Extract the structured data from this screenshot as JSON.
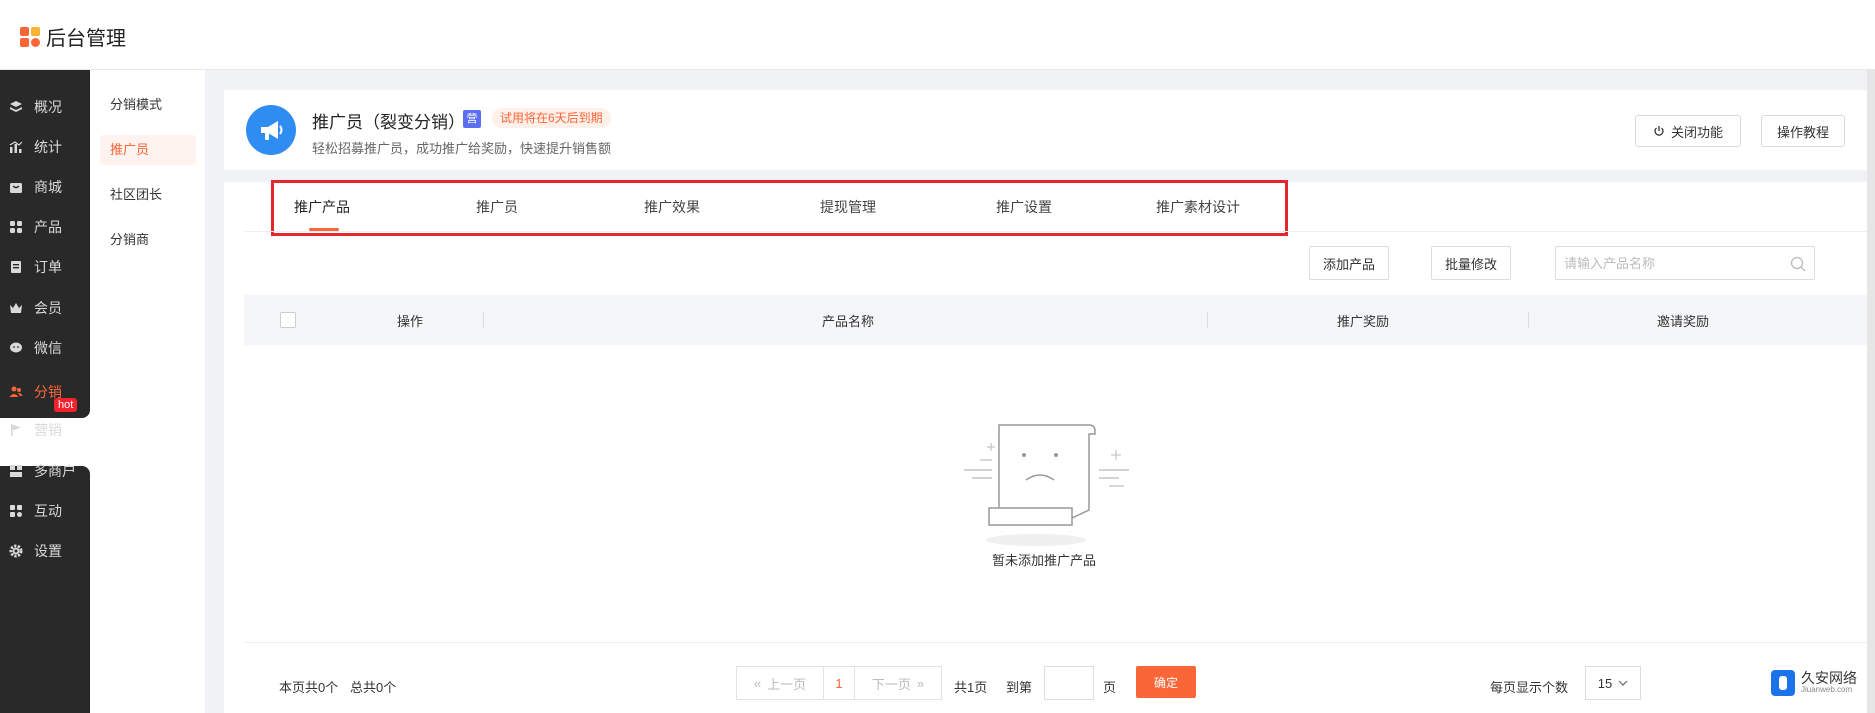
{
  "app": {
    "title": "后台管理"
  },
  "colors": {
    "accent": "#fb6638",
    "sidebar": "#292929",
    "highlight_box": "#e5262d",
    "logo": [
      "#fb6638",
      "#fdb336",
      "#fb6638",
      "#fb6638"
    ]
  },
  "sidebar": {
    "items": [
      {
        "label": "概况",
        "icon": "layers-icon"
      },
      {
        "label": "统计",
        "icon": "chart-icon"
      },
      {
        "label": "商城",
        "icon": "store-icon"
      },
      {
        "label": "产品",
        "icon": "grid-icon"
      },
      {
        "label": "订单",
        "icon": "order-icon"
      },
      {
        "label": "会员",
        "icon": "crown-icon"
      },
      {
        "label": "微信",
        "icon": "wechat-icon"
      },
      {
        "label": "分销",
        "icon": "users-icon",
        "active": true
      },
      {
        "label": "营销",
        "icon": "flag-icon",
        "badge": "hot"
      },
      {
        "label": "多商户",
        "icon": "shop-icon"
      },
      {
        "label": "互动",
        "icon": "apps-icon"
      },
      {
        "label": "设置",
        "icon": "gear-icon"
      }
    ]
  },
  "subnav": {
    "items": [
      {
        "label": "分销模式"
      },
      {
        "label": "推广员",
        "active": true
      },
      {
        "label": "社区团长"
      },
      {
        "label": "分销商"
      }
    ]
  },
  "header": {
    "title": "推广员（裂变分销）",
    "badge": "营",
    "trial": "试用将在6天后到期",
    "description": "轻松招募推广员，成功推广给奖励，快速提升销售额",
    "close_label": "关闭功能",
    "tutorial_label": "操作教程"
  },
  "tabs": [
    {
      "label": "推广产品",
      "active": true
    },
    {
      "label": "推广员"
    },
    {
      "label": "推广效果"
    },
    {
      "label": "提现管理"
    },
    {
      "label": "推广设置"
    },
    {
      "label": "推广素材设计"
    }
  ],
  "toolbar": {
    "add_label": "添加产品",
    "batch_label": "批量修改",
    "search_placeholder": "请输入产品名称"
  },
  "table": {
    "columns": [
      "操作",
      "产品名称",
      "推广奖励",
      "邀请奖励"
    ],
    "empty_text": "暂未添加推广产品"
  },
  "footer": {
    "page_count": "本页共0个",
    "total_count": "总共0个",
    "prev_label": "上一页",
    "current_page": "1",
    "next_label": "下一页",
    "total_pages": "共1页",
    "goto_label": "到第",
    "page_unit": "页",
    "confirm_label": "确定",
    "per_page_label": "每页显示个数",
    "per_page_value": "15"
  },
  "watermark": {
    "title": "久安网络",
    "sub": "Jiuanweb.com"
  }
}
